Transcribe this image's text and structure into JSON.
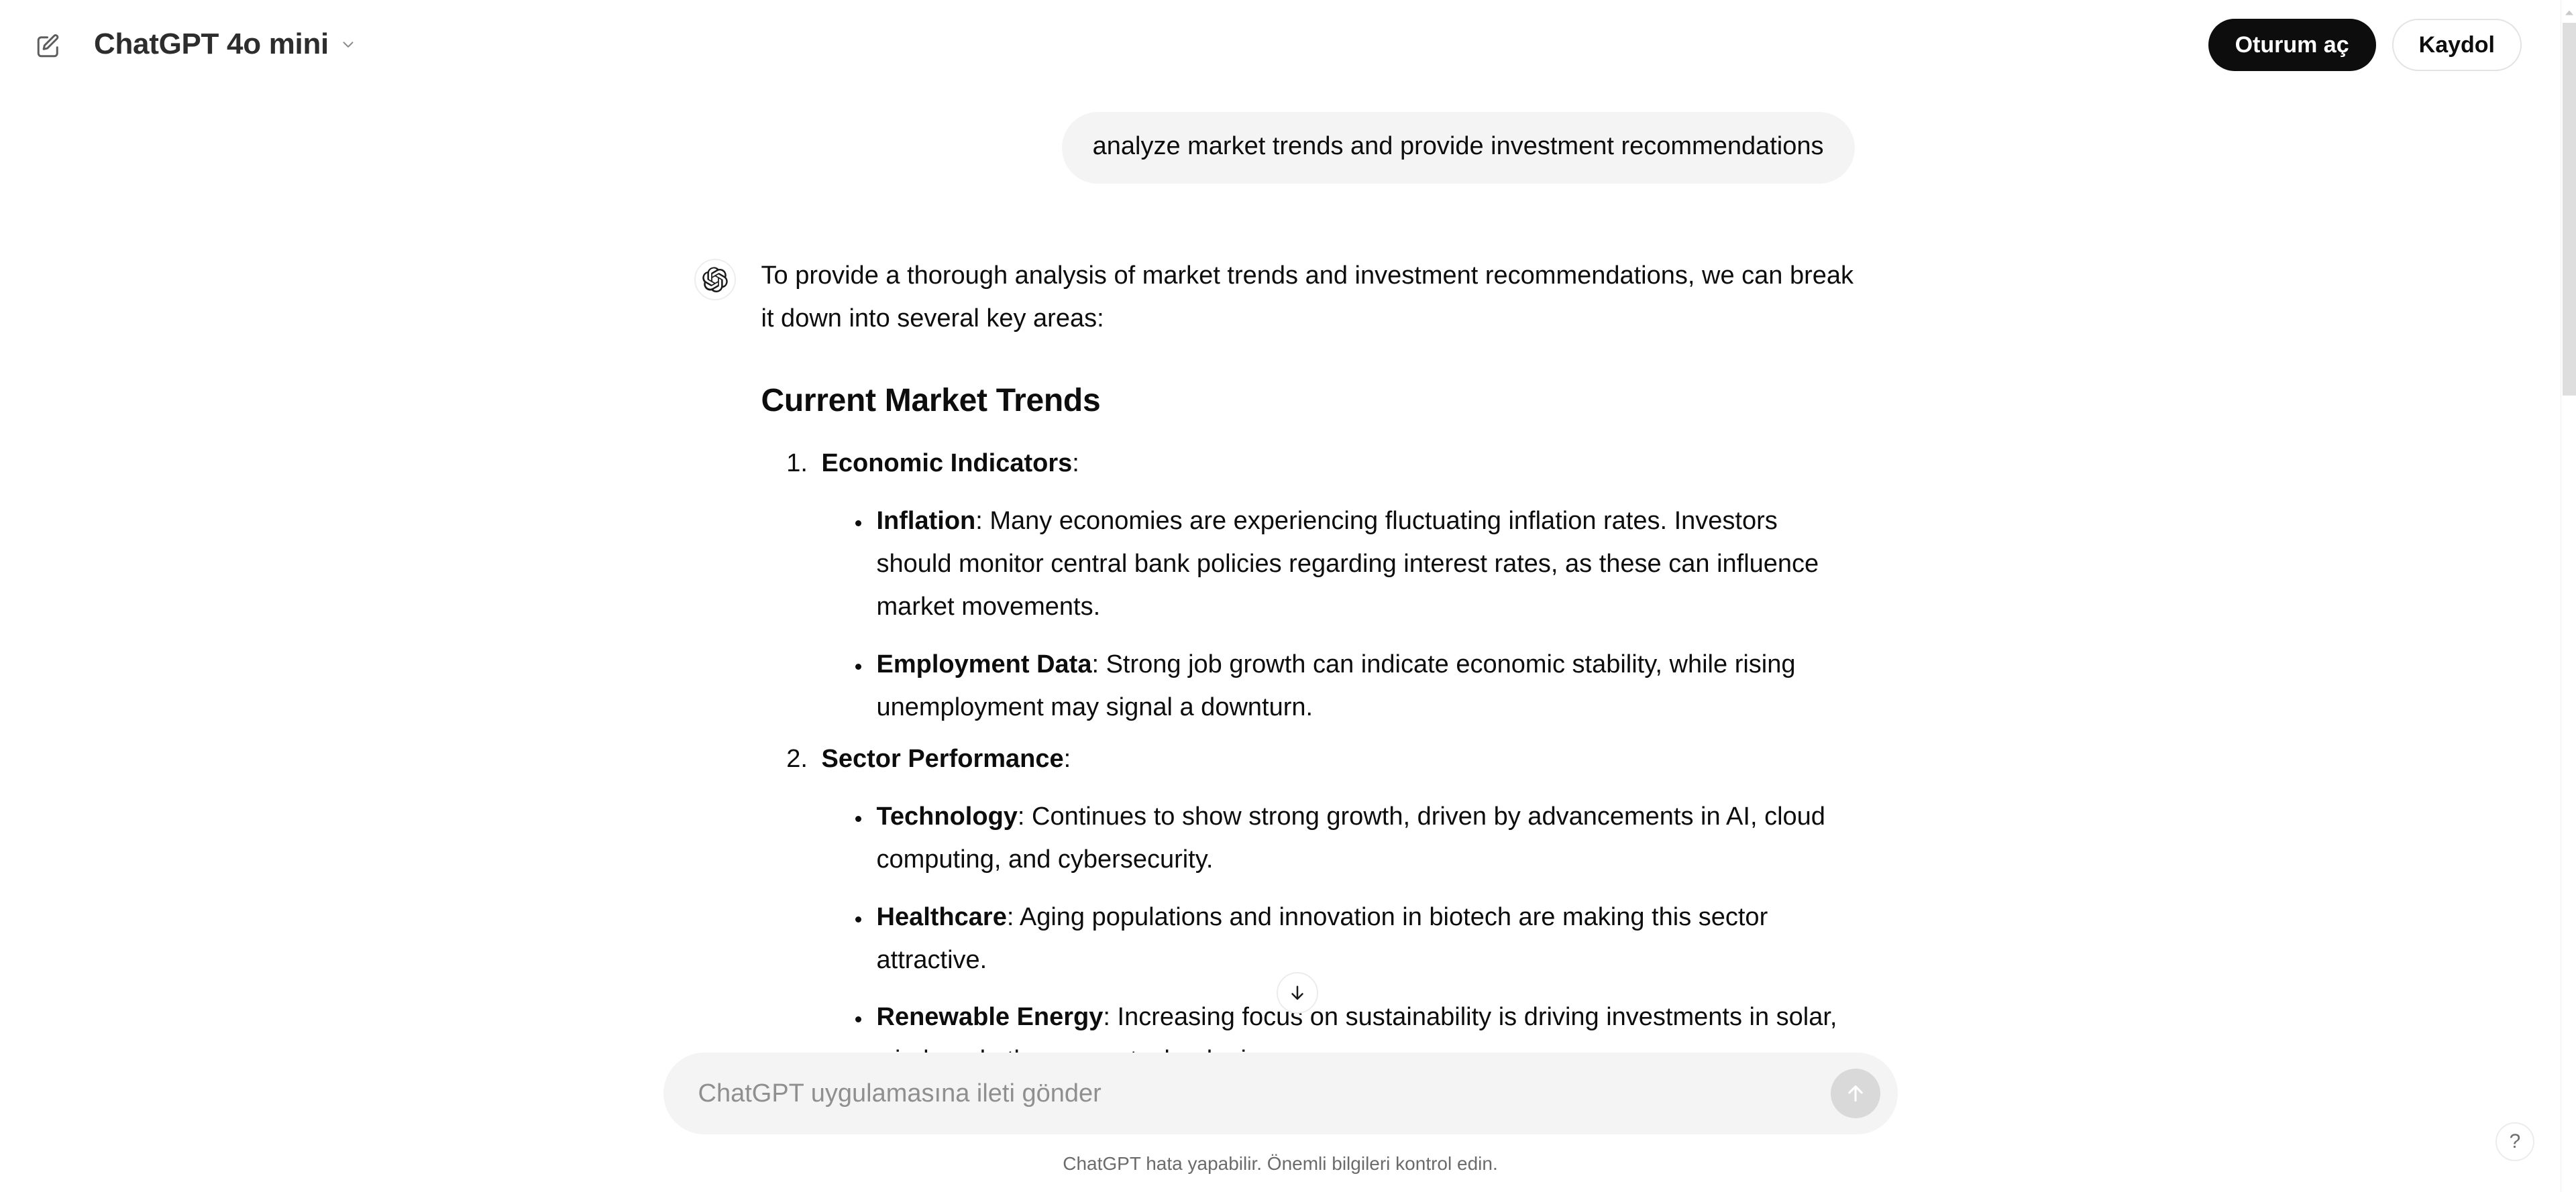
{
  "header": {
    "new_chat_icon": "compose-icon",
    "model_name": "ChatGPT 4o mini",
    "model_chevron_icon": "chevron-down-icon",
    "login_label": "Oturum aç",
    "signup_label": "Kaydol"
  },
  "conversation": {
    "user_message": "analyze market trends and provide investment recommendations",
    "assistant": {
      "avatar_icon": "openai-logo-icon",
      "intro": "To provide a thorough analysis of market trends and investment recommendations, we can break it down into several key areas:",
      "heading": "Current Market Trends",
      "items": [
        {
          "title": "Economic Indicators",
          "colon": ":",
          "bullets": [
            {
              "term": "Inflation",
              "text": ": Many economies are experiencing fluctuating inflation rates. Investors should monitor central bank policies regarding interest rates, as these can influence market movements."
            },
            {
              "term": "Employment Data",
              "text": ": Strong job growth can indicate economic stability, while rising unemployment may signal a downturn."
            }
          ]
        },
        {
          "title": "Sector Performance",
          "colon": ":",
          "bullets": [
            {
              "term": "Technology",
              "text": ": Continues to show strong growth, driven by advancements in AI, cloud computing, and cybersecurity."
            },
            {
              "term": "Healthcare",
              "text": ": Aging populations and innovation in biotech are making this sector attractive."
            },
            {
              "term": "Renewable Energy",
              "text": ": Increasing focus on sustainability is driving investments in solar, wind, and other green technologies."
            }
          ]
        }
      ]
    }
  },
  "scroll_down_button": {
    "icon": "arrow-down-icon"
  },
  "composer": {
    "placeholder": "ChatGPT uygulamasına ileti gönder",
    "value": "",
    "send_icon": "arrow-up-icon"
  },
  "footer": {
    "disclaimer": "ChatGPT hata yapabilir. Önemli bilgileri kontrol edin."
  },
  "help": {
    "label": "?"
  },
  "colors": {
    "accent_dark": "#0d0d0d",
    "bubble_gray": "#f4f4f4",
    "muted_text": "#6b6b6b",
    "send_disabled": "#d9d9d9"
  }
}
